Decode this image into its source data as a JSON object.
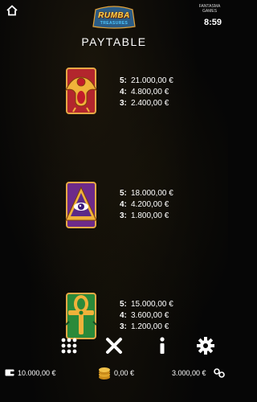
{
  "header": {
    "logo_title": "RUMBA",
    "logo_subtitle": "TREASURES",
    "brand": "FANTASMA GAMES",
    "time": "8:59"
  },
  "paytable": {
    "title": "PAYTABLE",
    "symbols": [
      {
        "icon": "scarab-icon",
        "payouts": [
          {
            "count": "5:",
            "amount": "21.000,00 €"
          },
          {
            "count": "4:",
            "amount": "4.800,00 €"
          },
          {
            "count": "3:",
            "amount": "2.400,00 €"
          }
        ]
      },
      {
        "icon": "eye-pyramid-icon",
        "payouts": [
          {
            "count": "5:",
            "amount": "18.000,00 €"
          },
          {
            "count": "4:",
            "amount": "4.200,00 €"
          },
          {
            "count": "3:",
            "amount": "1.800,00 €"
          }
        ]
      },
      {
        "icon": "ankh-icon",
        "payouts": [
          {
            "count": "5:",
            "amount": "15.000,00 €"
          },
          {
            "count": "4:",
            "amount": "3.600,00 €"
          },
          {
            "count": "3:",
            "amount": "1.200,00 €"
          }
        ]
      }
    ]
  },
  "controls": [
    "grid-menu-icon",
    "close-icon",
    "info-icon",
    "gear-icon"
  ],
  "footer": {
    "balance": "10.000,00 €",
    "win": "0,00 €",
    "bet": "3.000,00 €"
  },
  "colors": {
    "background": "#060606",
    "text": "#ffffff",
    "gold": "#ffd24a"
  }
}
